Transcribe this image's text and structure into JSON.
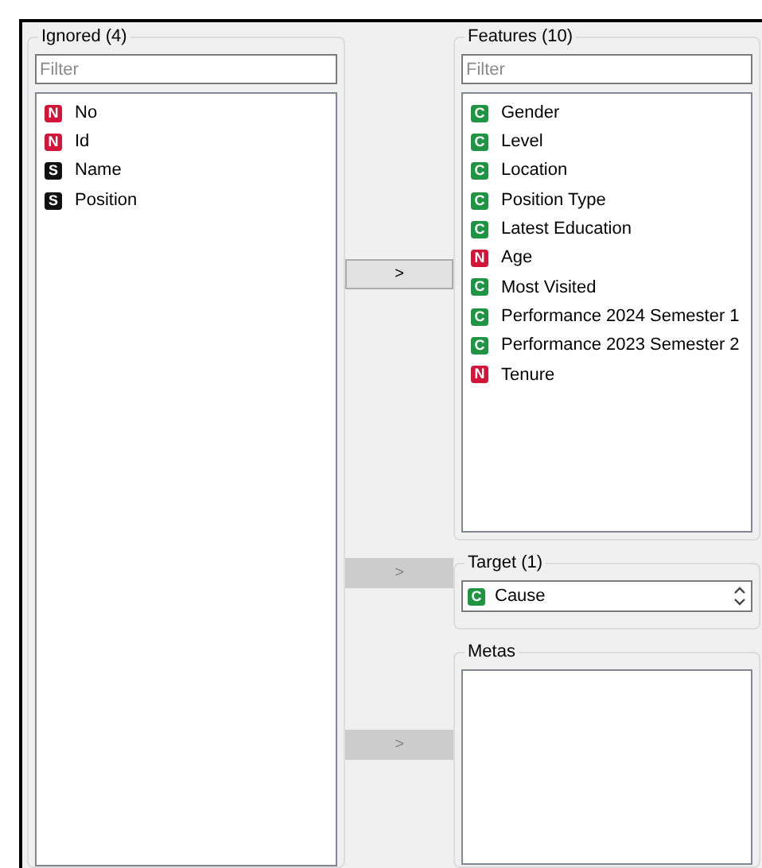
{
  "ignored": {
    "title": "Ignored (4)",
    "filter": {
      "placeholder": "Filter"
    },
    "items": [
      {
        "kind": "numeric",
        "badge": "N",
        "label": "No"
      },
      {
        "kind": "numeric",
        "badge": "N",
        "label": "Id"
      },
      {
        "kind": "string",
        "badge": "S",
        "label": "Name"
      },
      {
        "kind": "string",
        "badge": "S",
        "label": "Position"
      }
    ]
  },
  "move_buttons": [
    {
      "label": ">",
      "disabled": false
    },
    {
      "label": ">",
      "disabled": true
    },
    {
      "label": ">",
      "disabled": true
    }
  ],
  "features": {
    "title": "Features (10)",
    "filter": {
      "placeholder": "Filter"
    },
    "items": [
      {
        "kind": "categorical",
        "badge": "C",
        "label": "Gender"
      },
      {
        "kind": "categorical",
        "badge": "C",
        "label": "Level"
      },
      {
        "kind": "categorical",
        "badge": "C",
        "label": "Location"
      },
      {
        "kind": "categorical",
        "badge": "C",
        "label": "Position Type"
      },
      {
        "kind": "categorical",
        "badge": "C",
        "label": "Latest Education"
      },
      {
        "kind": "numeric",
        "badge": "N",
        "label": "Age"
      },
      {
        "kind": "categorical",
        "badge": "C",
        "label": "Most Visited"
      },
      {
        "kind": "categorical",
        "badge": "C",
        "label": "Performance 2024 Semester 1"
      },
      {
        "kind": "categorical",
        "badge": "C",
        "label": "Performance 2023 Semester 2"
      },
      {
        "kind": "numeric",
        "badge": "N",
        "label": "Tenure"
      }
    ]
  },
  "target": {
    "title": "Target (1)",
    "value": {
      "kind": "categorical",
      "badge": "C",
      "label": "Cause"
    }
  },
  "metas": {
    "title": "Metas"
  }
}
